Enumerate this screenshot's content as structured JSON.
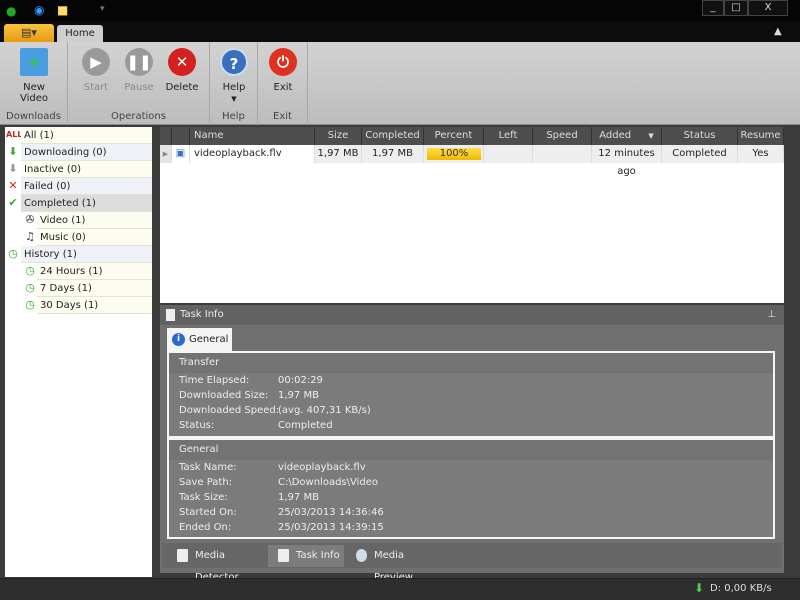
{
  "window": {
    "controls": [
      "_",
      "□",
      "X"
    ]
  },
  "ribbon": {
    "tabs": [
      {
        "label": "Home"
      }
    ],
    "groups": [
      {
        "label": "Downloads",
        "buttons": [
          {
            "label": "New Video",
            "icon": "new-video-icon",
            "enabled": true
          }
        ]
      },
      {
        "label": "Operations",
        "buttons": [
          {
            "label": "Start",
            "icon": "play-icon",
            "enabled": false
          },
          {
            "label": "Pause",
            "icon": "pause-icon",
            "enabled": false
          },
          {
            "label": "Delete",
            "icon": "delete-icon",
            "enabled": true
          }
        ]
      },
      {
        "label": "Help",
        "buttons": [
          {
            "label": "Help",
            "icon": "help-icon",
            "enabled": true
          }
        ]
      },
      {
        "label": "Exit",
        "buttons": [
          {
            "label": "Exit",
            "icon": "power-icon",
            "enabled": true
          }
        ]
      }
    ]
  },
  "sidebar": {
    "items": [
      {
        "label": "All (1)",
        "icon": "all-icon"
      },
      {
        "label": "Downloading (0)",
        "icon": "download-arrow-icon"
      },
      {
        "label": "Inactive (0)",
        "icon": "inactive-icon"
      },
      {
        "label": "Failed (0)",
        "icon": "failed-x-icon"
      },
      {
        "label": "Completed (1)",
        "icon": "check-icon",
        "selected": true
      },
      {
        "label": "Video (1)",
        "icon": "film-reel-icon"
      },
      {
        "label": "Music (0)",
        "icon": "music-note-icon"
      },
      {
        "label": "History (1)",
        "icon": "history-clock-icon"
      },
      {
        "label": "24 Hours (1)",
        "icon": "history-clock-icon"
      },
      {
        "label": "7 Days (1)",
        "icon": "history-clock-icon"
      },
      {
        "label": "30 Days (1)",
        "icon": "history-clock-icon"
      }
    ]
  },
  "grid": {
    "columns": [
      "Name",
      "Size",
      "Completed",
      "Percent",
      "Left",
      "Speed",
      "Added",
      "Status",
      "Resume"
    ],
    "rows": [
      {
        "name": "videoplayback.flv",
        "size": "1,97 MB",
        "completed": "1,97 MB",
        "percent": "100%",
        "percent_value": 100,
        "left": "",
        "speed": "",
        "added": "12 minutes ago",
        "status": "Completed",
        "resume": "Yes"
      }
    ]
  },
  "taskinfo": {
    "title": "Task Info",
    "tab": "General",
    "transfer": {
      "title": "Transfer",
      "rows": [
        {
          "k": "Time Elapsed:",
          "v": "00:02:29"
        },
        {
          "k": "Downloaded Size:",
          "v": "1,97 MB"
        },
        {
          "k": "Downloaded Speed:",
          "v": "(avg. 407,31 KB/s)"
        },
        {
          "k": "Status:",
          "v": "Completed"
        }
      ]
    },
    "general": {
      "title": "General",
      "rows": [
        {
          "k": "Task Name:",
          "v": "videoplayback.flv"
        },
        {
          "k": "Save Path:",
          "v": "C:\\Downloads\\Video"
        },
        {
          "k": "Task Size:",
          "v": "1,97 MB"
        },
        {
          "k": "Started On:",
          "v": "25/03/2013 14:36:46"
        },
        {
          "k": "Ended On:",
          "v": "25/03/2013 14:39:15"
        }
      ]
    },
    "bottom_tabs": [
      "Media Detector",
      "Task Info",
      "Media Preview"
    ]
  },
  "statusbar": {
    "speed": "D: 0,00 KB/s"
  },
  "colors": {
    "accent": "#f0b800",
    "ribbon": "#c8c8c8",
    "panel": "#707070"
  }
}
